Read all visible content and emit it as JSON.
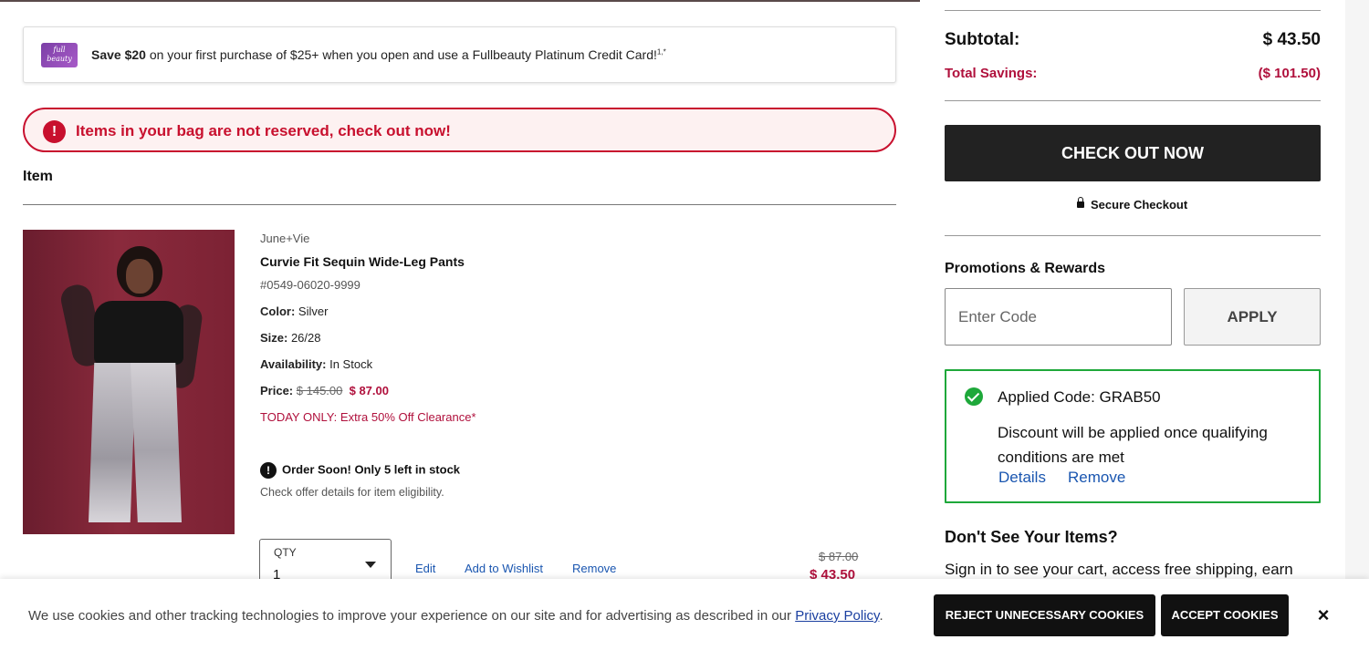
{
  "promo_banner": {
    "logo_text": "full beauty",
    "bold": "Save $20",
    "text": " on your first purchase of $25+ when you open and use a Fullbeauty Platinum Credit Card!",
    "sup": "1,*"
  },
  "alert": {
    "icon": "!",
    "text": "Items in your bag are not reserved, check out now!"
  },
  "cart": {
    "column_header": "Item",
    "item": {
      "brand": "June+Vie",
      "name": "Curvie Fit Sequin Wide-Leg Pants",
      "sku": "#0549-06020-9999",
      "color_label": "Color:",
      "color": " Silver",
      "size_label": "Size:",
      "size": " 26/28",
      "availability_label": "Availability:",
      "availability": " In Stock",
      "price_label": "Price:",
      "original_price": "$ 145.00",
      "sale_price": "$ 87.00",
      "promo_text": "TODAY ONLY: Extra 50% Off Clearance*",
      "order_soon": "Order Soon! Only 5 left in stock",
      "order_soon_icon": "!",
      "offer_note": "Check offer details for item eligibility.",
      "qty_label": "QTY",
      "qty_value": "1",
      "edit": "Edit",
      "wishlist": "Add to Wishlist",
      "remove": "Remove",
      "line_original": "$ 87.00",
      "line_total": "$ 43.50"
    }
  },
  "summary": {
    "subtotal_label": "Subtotal:",
    "subtotal": "$ 43.50",
    "savings_label": "Total Savings:",
    "savings": "($ 101.50)",
    "checkout_label": "CHECK OUT NOW",
    "secure_label": "Secure Checkout",
    "promotions_title": "Promotions & Rewards",
    "code_placeholder": "Enter Code",
    "apply_label": "APPLY",
    "applied_title": "Applied Code: GRAB50",
    "applied_desc": "Discount will be applied once qualifying conditions are met",
    "details_link": "Details",
    "remove_link": "Remove",
    "dont_see_title": "Don't See Your Items?",
    "sign_in_text": "Sign in to see your cart, access free shipping, earn"
  },
  "cookie": {
    "text": "We use cookies and other tracking technologies to improve your experience on our site and for advertising as described in our ",
    "link": "Privacy Policy",
    "after": ".",
    "reject": "REJECT UNNECESSARY COOKIES",
    "accept": "ACCEPT COOKIES",
    "close": "×"
  },
  "colors": {
    "brand_red": "#c8102e",
    "sale": "#b0103c",
    "success": "#1ea83a",
    "link": "#1a56b0",
    "dark_button": "#222222"
  },
  "icons": [
    "alert-icon",
    "exclamation-icon",
    "lock-icon",
    "check-circle-icon",
    "chevron-down-icon",
    "close-icon"
  ]
}
